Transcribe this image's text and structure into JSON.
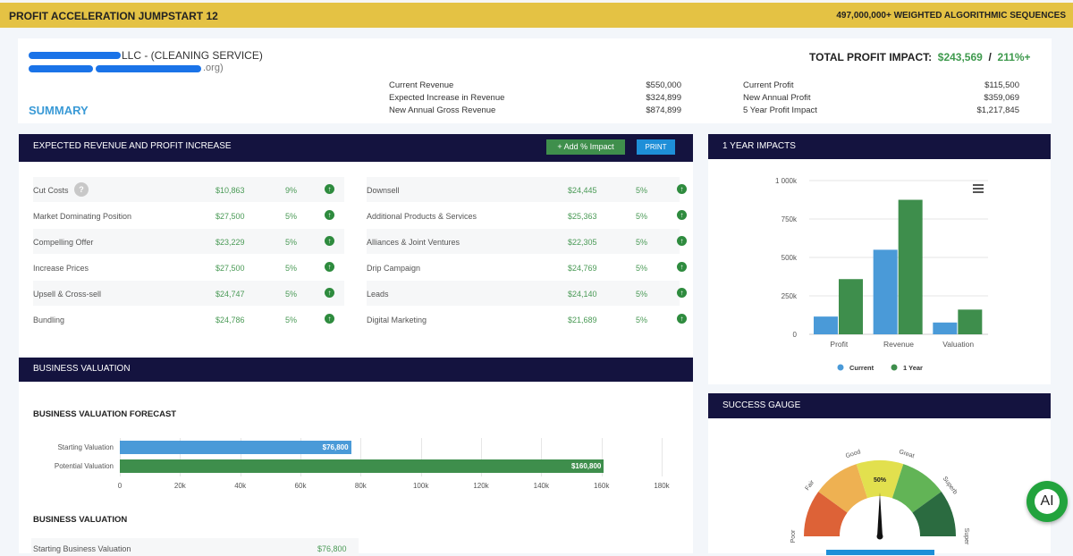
{
  "header": {
    "title": "PROFIT ACCELERATION JUMPSTART 12",
    "tagline": "497,000,000+ WEIGHTED ALGORITHMIC SEQUENCES"
  },
  "summary": {
    "company": "LLC - (CLEANING SERVICE)",
    "email_suffix": ".org)",
    "title": "SUMMARY",
    "total_label": "TOTAL PROFIT IMPACT:",
    "total_value": "$243,569",
    "separator": "/",
    "total_pct": "211%+",
    "revenue": [
      {
        "label": "Current Revenue",
        "value": "$550,000"
      },
      {
        "label": "Expected Increase in Revenue",
        "value": "$324,899"
      },
      {
        "label": "New Annual Gross Revenue",
        "value": "$874,899"
      }
    ],
    "profit": [
      {
        "label": "Current Profit",
        "value": "$115,500"
      },
      {
        "label": "New Annual Profit",
        "value": "$359,069"
      },
      {
        "label": "5 Year Profit Impact",
        "value": "$1,217,845"
      }
    ]
  },
  "increase": {
    "title": "EXPECTED REVENUE AND PROFIT INCREASE",
    "add_label": "+ Add % Impact",
    "print_label": "PRINT",
    "help": "?",
    "up": "↑",
    "left": [
      {
        "name": "Cut Costs",
        "amount": "$10,863",
        "pct": "9%"
      },
      {
        "name": "Market Dominating Position",
        "amount": "$27,500",
        "pct": "5%"
      },
      {
        "name": "Compelling Offer",
        "amount": "$23,229",
        "pct": "5%"
      },
      {
        "name": "Increase Prices",
        "amount": "$27,500",
        "pct": "5%"
      },
      {
        "name": "Upsell & Cross-sell",
        "amount": "$24,747",
        "pct": "5%"
      },
      {
        "name": "Bundling",
        "amount": "$24,786",
        "pct": "5%"
      }
    ],
    "right": [
      {
        "name": "Downsell",
        "amount": "$24,445",
        "pct": "5%"
      },
      {
        "name": "Additional Products & Services",
        "amount": "$25,363",
        "pct": "5%"
      },
      {
        "name": "Alliances & Joint Ventures",
        "amount": "$22,305",
        "pct": "5%"
      },
      {
        "name": "Drip Campaign",
        "amount": "$24,769",
        "pct": "5%"
      },
      {
        "name": "Leads",
        "amount": "$24,140",
        "pct": "5%"
      },
      {
        "name": "Digital Marketing",
        "amount": "$21,689",
        "pct": "5%"
      }
    ]
  },
  "valuation": {
    "title": "BUSINESS VALUATION",
    "forecast_title": "BUSINESS VALUATION FORECAST",
    "section2": "BUSINESS VALUATION",
    "starting_label": "Starting Business Valuation",
    "starting_value": "$76,800"
  },
  "impacts": {
    "title": "1 YEAR IMPACTS"
  },
  "gauge": {
    "title": "SUCCESS GAUGE",
    "value_label": "50%",
    "value": 50,
    "labels": [
      "Poor",
      "Fair",
      "Good",
      "Great",
      "Superb",
      "Super"
    ],
    "colors": [
      "#dd6237",
      "#eeb152",
      "#e2e04e",
      "#62b456",
      "#2b6b40"
    ]
  },
  "ai_label": "AI",
  "chart_data": [
    {
      "type": "bar",
      "title": "1 YEAR IMPACTS",
      "categories": [
        "Profit",
        "Revenue",
        "Valuation"
      ],
      "series": [
        {
          "name": "Current",
          "color": "#4a9ad8",
          "values": [
            115500,
            550000,
            76800
          ]
        },
        {
          "name": "1 Year",
          "color": "#3e8e4c",
          "values": [
            359069,
            874899,
            160800
          ]
        }
      ],
      "ylim": [
        0,
        1000000
      ],
      "yticks": [
        "0",
        "250k",
        "500k",
        "750k",
        "1 000k"
      ],
      "ytick_values": [
        0,
        250000,
        500000,
        750000,
        1000000
      ],
      "legend": "bottom",
      "grid": true
    },
    {
      "type": "bar",
      "orientation": "horizontal",
      "title": "BUSINESS VALUATION FORECAST",
      "categories": [
        "Starting Valuation",
        "Potential Valuation"
      ],
      "values": [
        76800,
        160800
      ],
      "labels": [
        "$76,800",
        "$160,800"
      ],
      "colors": [
        "#4a9ad8",
        "#3e8e4c"
      ],
      "xlim": [
        0,
        180000
      ],
      "xticks": [
        "0",
        "20k",
        "40k",
        "60k",
        "80k",
        "100k",
        "120k",
        "140k",
        "160k",
        "180k"
      ]
    }
  ]
}
